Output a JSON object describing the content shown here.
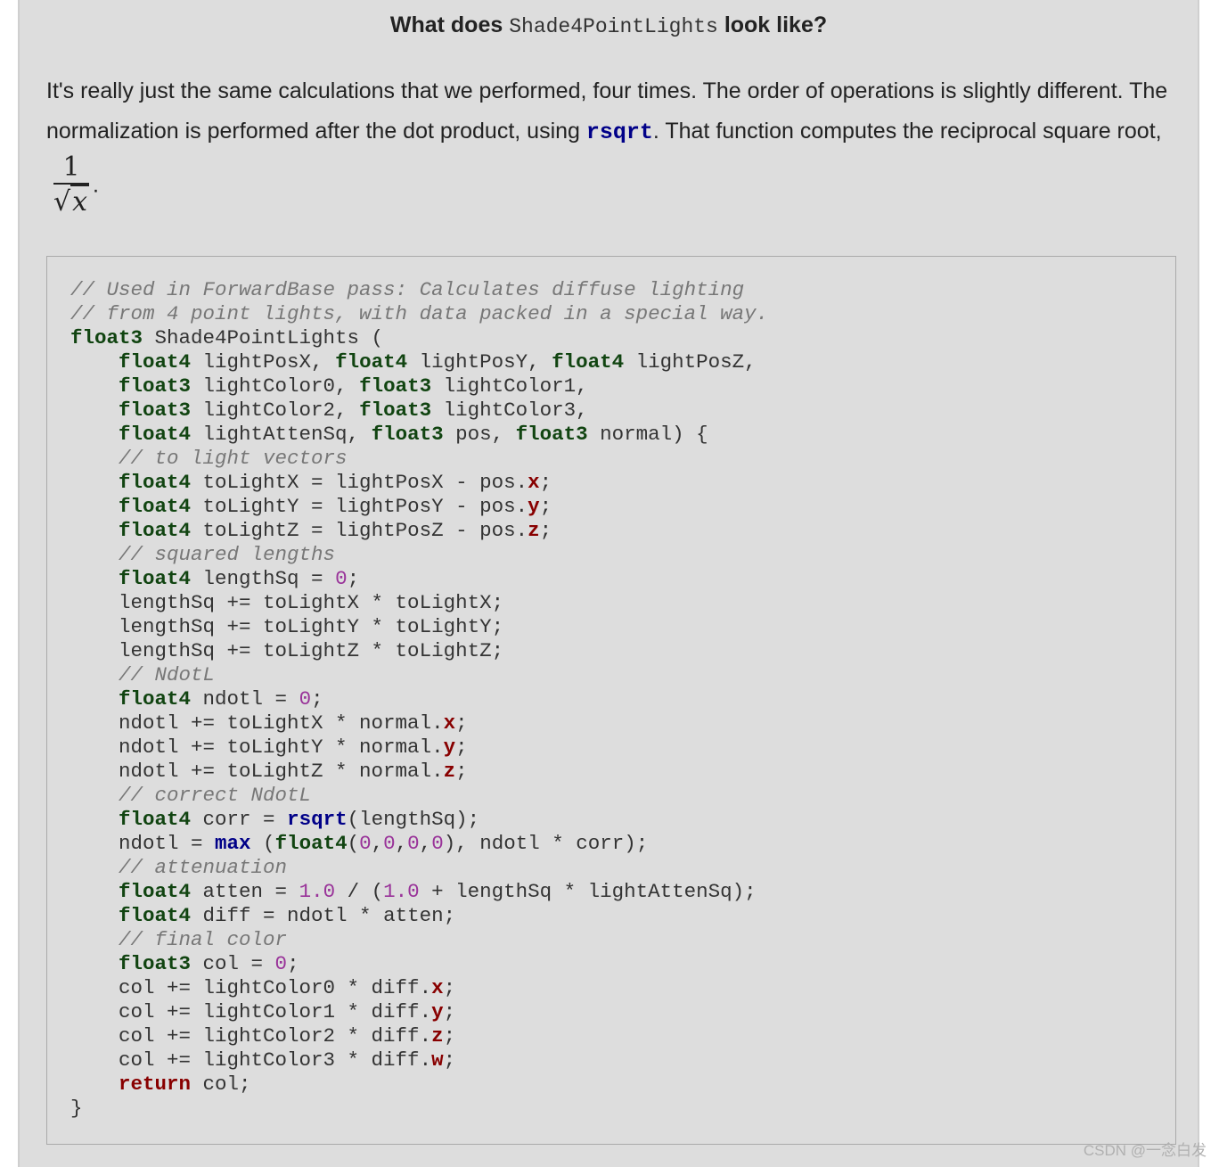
{
  "heading": {
    "prefix": "What does",
    "code": "Shade4PointLights",
    "suffix": "look like?"
  },
  "paragraph": {
    "text1": "It's really just the same calculations that we performed, four times. The order of operations is slightly different. The normalization is performed after the dot product, using",
    "code": "rsqrt",
    "text2": ". That function computes the reciprocal square root,",
    "frac_num": "1",
    "frac_den_symbol": "√",
    "frac_den_var": "x",
    "end": "."
  },
  "code_lines": [
    [
      [
        "c",
        "// Used in ForwardBase pass: Calculates diffuse lighting"
      ]
    ],
    [
      [
        "c",
        "// from 4 point lights, with data packed in a special way."
      ]
    ],
    [
      [
        "t",
        "float3"
      ],
      [
        "p",
        " Shade4PointLights ("
      ]
    ],
    [
      [
        "p",
        "    "
      ],
      [
        "t",
        "float4"
      ],
      [
        "p",
        " lightPosX, "
      ],
      [
        "t",
        "float4"
      ],
      [
        "p",
        " lightPosY, "
      ],
      [
        "t",
        "float4"
      ],
      [
        "p",
        " lightPosZ,"
      ]
    ],
    [
      [
        "p",
        "    "
      ],
      [
        "t",
        "float3"
      ],
      [
        "p",
        " lightColor0, "
      ],
      [
        "t",
        "float3"
      ],
      [
        "p",
        " lightColor1,"
      ]
    ],
    [
      [
        "p",
        "    "
      ],
      [
        "t",
        "float3"
      ],
      [
        "p",
        " lightColor2, "
      ],
      [
        "t",
        "float3"
      ],
      [
        "p",
        " lightColor3,"
      ]
    ],
    [
      [
        "p",
        "    "
      ],
      [
        "t",
        "float4"
      ],
      [
        "p",
        " lightAttenSq, "
      ],
      [
        "t",
        "float3"
      ],
      [
        "p",
        " pos, "
      ],
      [
        "t",
        "float3"
      ],
      [
        "p",
        " normal) {"
      ]
    ],
    [
      [
        "p",
        "    "
      ],
      [
        "c",
        "// to light vectors"
      ]
    ],
    [
      [
        "p",
        "    "
      ],
      [
        "t",
        "float4"
      ],
      [
        "p",
        " toLightX = lightPosX - pos."
      ],
      [
        "k",
        "x"
      ],
      [
        "p",
        ";"
      ]
    ],
    [
      [
        "p",
        "    "
      ],
      [
        "t",
        "float4"
      ],
      [
        "p",
        " toLightY = lightPosY - pos."
      ],
      [
        "k",
        "y"
      ],
      [
        "p",
        ";"
      ]
    ],
    [
      [
        "p",
        "    "
      ],
      [
        "t",
        "float4"
      ],
      [
        "p",
        " toLightZ = lightPosZ - pos."
      ],
      [
        "k",
        "z"
      ],
      [
        "p",
        ";"
      ]
    ],
    [
      [
        "p",
        "    "
      ],
      [
        "c",
        "// squared lengths"
      ]
    ],
    [
      [
        "p",
        "    "
      ],
      [
        "t",
        "float4"
      ],
      [
        "p",
        " lengthSq = "
      ],
      [
        "n",
        "0"
      ],
      [
        "p",
        ";"
      ]
    ],
    [
      [
        "p",
        "    lengthSq += toLightX * toLightX;"
      ]
    ],
    [
      [
        "p",
        "    lengthSq += toLightY * toLightY;"
      ]
    ],
    [
      [
        "p",
        "    lengthSq += toLightZ * toLightZ;"
      ]
    ],
    [
      [
        "p",
        "    "
      ],
      [
        "c",
        "// NdotL"
      ]
    ],
    [
      [
        "p",
        "    "
      ],
      [
        "t",
        "float4"
      ],
      [
        "p",
        " ndotl = "
      ],
      [
        "n",
        "0"
      ],
      [
        "p",
        ";"
      ]
    ],
    [
      [
        "p",
        "    ndotl += toLightX * normal."
      ],
      [
        "k",
        "x"
      ],
      [
        "p",
        ";"
      ]
    ],
    [
      [
        "p",
        "    ndotl += toLightY * normal."
      ],
      [
        "k",
        "y"
      ],
      [
        "p",
        ";"
      ]
    ],
    [
      [
        "p",
        "    ndotl += toLightZ * normal."
      ],
      [
        "k",
        "z"
      ],
      [
        "p",
        ";"
      ]
    ],
    [
      [
        "p",
        "    "
      ],
      [
        "c",
        "// correct NdotL"
      ]
    ],
    [
      [
        "p",
        "    "
      ],
      [
        "t",
        "float4"
      ],
      [
        "p",
        " corr = "
      ],
      [
        "f",
        "rsqrt"
      ],
      [
        "p",
        "(lengthSq);"
      ]
    ],
    [
      [
        "p",
        "    ndotl = "
      ],
      [
        "f",
        "max"
      ],
      [
        "p",
        " ("
      ],
      [
        "t",
        "float4"
      ],
      [
        "p",
        "("
      ],
      [
        "n",
        "0"
      ],
      [
        "p",
        ","
      ],
      [
        "n",
        "0"
      ],
      [
        "p",
        ","
      ],
      [
        "n",
        "0"
      ],
      [
        "p",
        ","
      ],
      [
        "n",
        "0"
      ],
      [
        "p",
        "), ndotl * corr);"
      ]
    ],
    [
      [
        "p",
        "    "
      ],
      [
        "c",
        "// attenuation"
      ]
    ],
    [
      [
        "p",
        "    "
      ],
      [
        "t",
        "float4"
      ],
      [
        "p",
        " atten = "
      ],
      [
        "n",
        "1.0"
      ],
      [
        "p",
        " / ("
      ],
      [
        "n",
        "1.0"
      ],
      [
        "p",
        " + lengthSq * lightAttenSq);"
      ]
    ],
    [
      [
        "p",
        "    "
      ],
      [
        "t",
        "float4"
      ],
      [
        "p",
        " diff = ndotl * atten;"
      ]
    ],
    [
      [
        "p",
        "    "
      ],
      [
        "c",
        "// final color"
      ]
    ],
    [
      [
        "p",
        "    "
      ],
      [
        "t",
        "float3"
      ],
      [
        "p",
        " col = "
      ],
      [
        "n",
        "0"
      ],
      [
        "p",
        ";"
      ]
    ],
    [
      [
        "p",
        "    col += lightColor0 * diff."
      ],
      [
        "k",
        "x"
      ],
      [
        "p",
        ";"
      ]
    ],
    [
      [
        "p",
        "    col += lightColor1 * diff."
      ],
      [
        "k",
        "y"
      ],
      [
        "p",
        ";"
      ]
    ],
    [
      [
        "p",
        "    col += lightColor2 * diff."
      ],
      [
        "k",
        "z"
      ],
      [
        "p",
        ";"
      ]
    ],
    [
      [
        "p",
        "    col += lightColor3 * diff."
      ],
      [
        "k",
        "w"
      ],
      [
        "p",
        ";"
      ]
    ],
    [
      [
        "p",
        "    "
      ],
      [
        "k",
        "return"
      ],
      [
        "p",
        " col;"
      ]
    ],
    [
      [
        "p",
        "}"
      ]
    ]
  ],
  "watermark": "CSDN @一念白发",
  "colors": {
    "background": "#dddddd",
    "comment": "#777777",
    "type": "#114411",
    "function": "#000088",
    "keyword": "#880000",
    "number": "#993399"
  }
}
